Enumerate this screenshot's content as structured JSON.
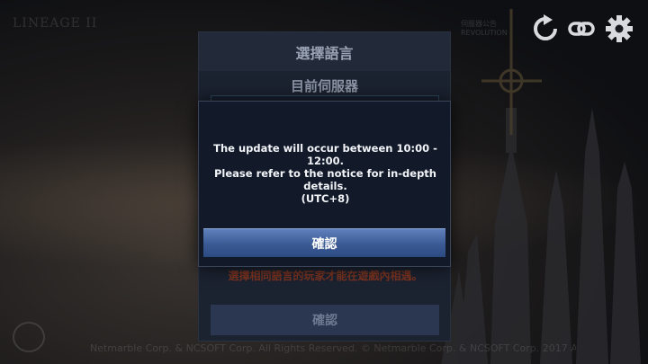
{
  "background": {
    "game_logo": "LINEAGE II",
    "top_right_text": [
      "伺服器公告",
      "REVOLUTION"
    ],
    "footer_copyright": "Netmarble Corp. & NCSOFT Corp. All Rights Reserved. © Netmarble Corp. & NCSOFT Corp. 2017 All Rights Reserved."
  },
  "top_icons": [
    "refresh-icon",
    "link-icon",
    "gear-icon"
  ],
  "language_panel": {
    "title": "選擇語言",
    "current_server_label": "目前伺服器",
    "warning": "選擇相同語言的玩家才能在遊戲內相遇。",
    "confirm_label": "確認"
  },
  "modal": {
    "message_lines": [
      "The update will occur between 10:00 - 12:00.",
      "Please refer to the notice for in-depth details.",
      "(UTC+8)"
    ],
    "confirm_label": "確認"
  },
  "colors": {
    "modal_bg": "#121a2a",
    "button_blue": "#3b5a94",
    "warning_red": "#7a3320"
  }
}
